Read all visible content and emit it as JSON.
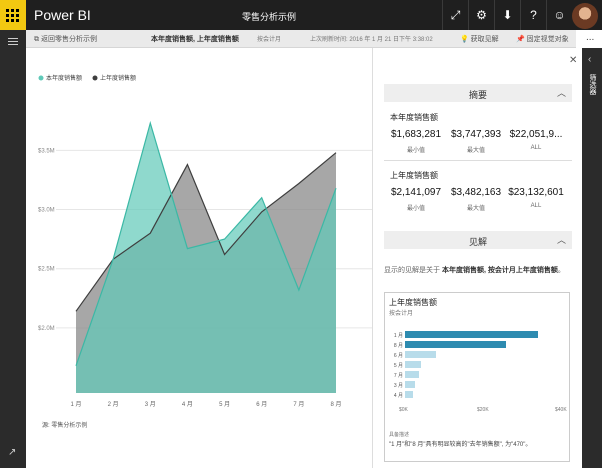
{
  "app": {
    "name": "Power BI",
    "report_title": "零售分析示例"
  },
  "topbar_icons": [
    "expand-icon",
    "gear-icon",
    "download-icon",
    "help-icon",
    "smiley-icon"
  ],
  "toolbar": {
    "back_label": "返回零售分析示例",
    "crumb": "本年度销售额, 上年度销售额",
    "crumb_sub": "按会计月",
    "updated": "上次刷新时间: 2016 年 1 月 21 日下午 3:38:02",
    "insights_label": "获取见解",
    "pin_label": "固定视觉对象",
    "more": "..."
  },
  "filter_label": "筛选器",
  "chart_data": {
    "type": "area",
    "categories": [
      "1 月",
      "2 月",
      "3 月",
      "4 月",
      "5 月",
      "6 月",
      "7 月",
      "8 月"
    ],
    "series": [
      {
        "name": "本年度销售额",
        "values": [
          1.68,
          2.58,
          3.73,
          2.67,
          2.75,
          3.1,
          2.32,
          3.18
        ],
        "color": "#5fc9b8"
      },
      {
        "name": "上年度销售额",
        "values": [
          2.14,
          2.58,
          2.8,
          3.38,
          2.62,
          2.98,
          3.22,
          3.48
        ],
        "color": "#3e3e3e"
      }
    ],
    "yticks": [
      "$2.0M",
      "$2.5M",
      "$3.0M",
      "$3.5M"
    ],
    "ylim": [
      1.45,
      3.9
    ],
    "grid": true,
    "legend": "top-left"
  },
  "source": "源: 零售分析示例",
  "summary": {
    "header": "摘要",
    "groups": [
      {
        "title": "本年度销售额",
        "stats": [
          {
            "value": "$1,683,281",
            "label": "最小值"
          },
          {
            "value": "$3,747,393",
            "label": "最大值"
          },
          {
            "value": "$22,051,9...",
            "label": "ALL"
          }
        ]
      },
      {
        "title": "上年度销售额",
        "stats": [
          {
            "value": "$2,141,097",
            "label": "最小值"
          },
          {
            "value": "$3,482,163",
            "label": "最大值"
          },
          {
            "value": "$23,132,601",
            "label": "ALL"
          }
        ]
      }
    ]
  },
  "insights": {
    "header": "见解",
    "text_prefix": "显示的见解是关于",
    "text_bold": "本年度销售额, 按会计月上年度销售额",
    "text_suffix": "。",
    "card": {
      "title": "上年度销售额",
      "subtitle": "按会计月",
      "bars": [
        {
          "label": "1 月",
          "value": 34,
          "color": "#2e8bb0"
        },
        {
          "label": "8 月",
          "value": 26,
          "color": "#2e8bb0"
        },
        {
          "label": "6 月",
          "value": 8,
          "color": "#b8dcea"
        },
        {
          "label": "5 月",
          "value": 4,
          "color": "#b8dcea"
        },
        {
          "label": "7 月",
          "value": 3.5,
          "color": "#b8dcea"
        },
        {
          "label": "3 月",
          "value": 2.5,
          "color": "#b8dcea"
        },
        {
          "label": "4 月",
          "value": 2,
          "color": "#b8dcea"
        }
      ],
      "xticks": [
        "$0K",
        "$20K",
        "$40K"
      ],
      "note_header": "具备描述",
      "note": "\"1 月\"和\"8 月\"具有明显较高的\"去年销售额\", 为\"470\"。"
    }
  }
}
